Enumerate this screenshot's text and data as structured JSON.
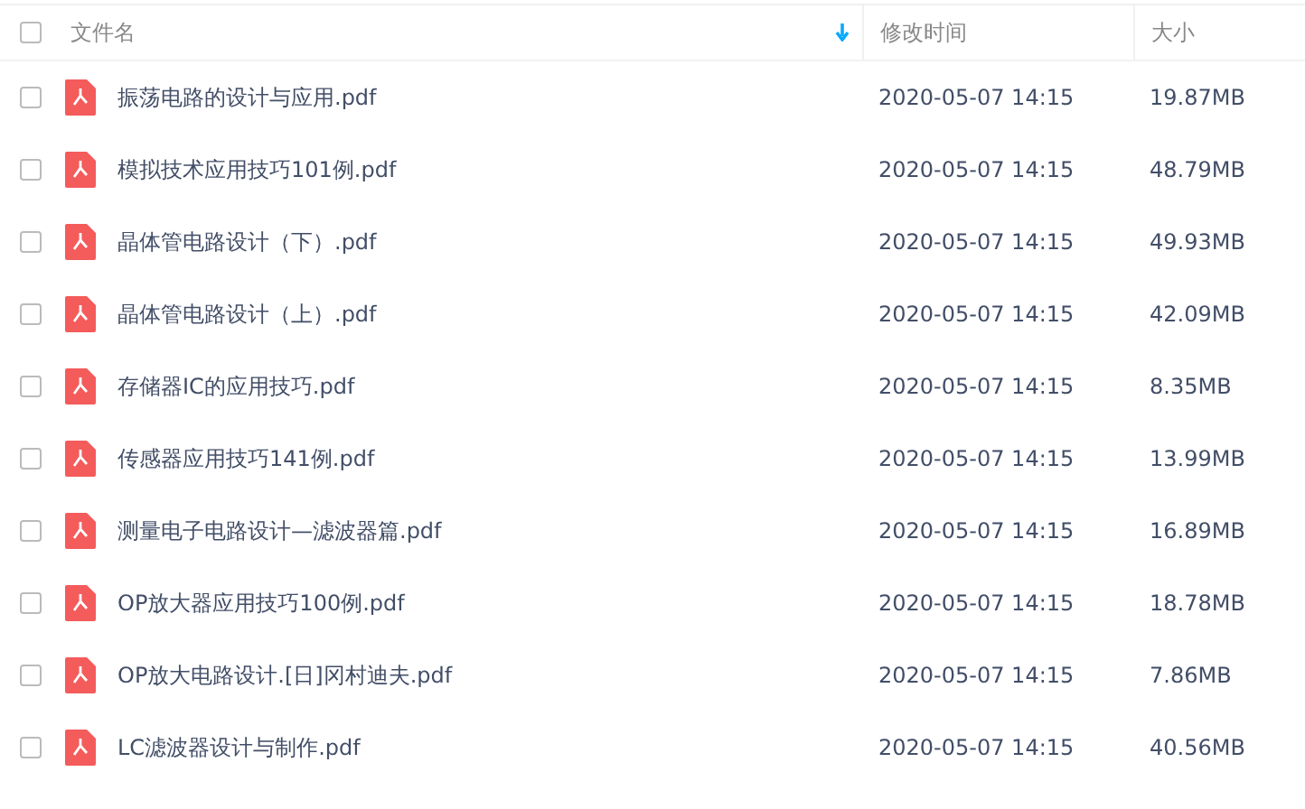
{
  "table": {
    "columns": [
      {
        "label": "文件名",
        "sorted": true
      },
      {
        "label": "修改时间",
        "sorted": false
      },
      {
        "label": "大小",
        "sorted": false
      }
    ],
    "select_all": {
      "checked": false
    },
    "rows": [
      {
        "name": "振荡电路的设计与应用.pdf",
        "modified": "2020-05-07 14:15",
        "size": "19.87MB",
        "checked": false
      },
      {
        "name": "模拟技术应用技巧101例.pdf",
        "modified": "2020-05-07 14:15",
        "size": "48.79MB",
        "checked": false
      },
      {
        "name": "晶体管电路设计（下）.pdf",
        "modified": "2020-05-07 14:15",
        "size": "49.93MB",
        "checked": false
      },
      {
        "name": "晶体管电路设计（上）.pdf",
        "modified": "2020-05-07 14:15",
        "size": "42.09MB",
        "checked": false
      },
      {
        "name": "存储器IC的应用技巧.pdf",
        "modified": "2020-05-07 14:15",
        "size": "8.35MB",
        "checked": false
      },
      {
        "name": "传感器应用技巧141例.pdf",
        "modified": "2020-05-07 14:15",
        "size": "13.99MB",
        "checked": false
      },
      {
        "name": "测量电子电路设计—滤波器篇.pdf",
        "modified": "2020-05-07 14:15",
        "size": "16.89MB",
        "checked": false
      },
      {
        "name": "OP放大器应用技巧100例.pdf",
        "modified": "2020-05-07 14:15",
        "size": "18.78MB",
        "checked": false
      },
      {
        "name": "OP放大电路设计.[日]冈村迪夫.pdf",
        "modified": "2020-05-07 14:15",
        "size": "7.86MB",
        "checked": false
      },
      {
        "name": "LC滤波器设计与制作.pdf",
        "modified": "2020-05-07 14:15",
        "size": "40.56MB",
        "checked": false
      }
    ]
  }
}
